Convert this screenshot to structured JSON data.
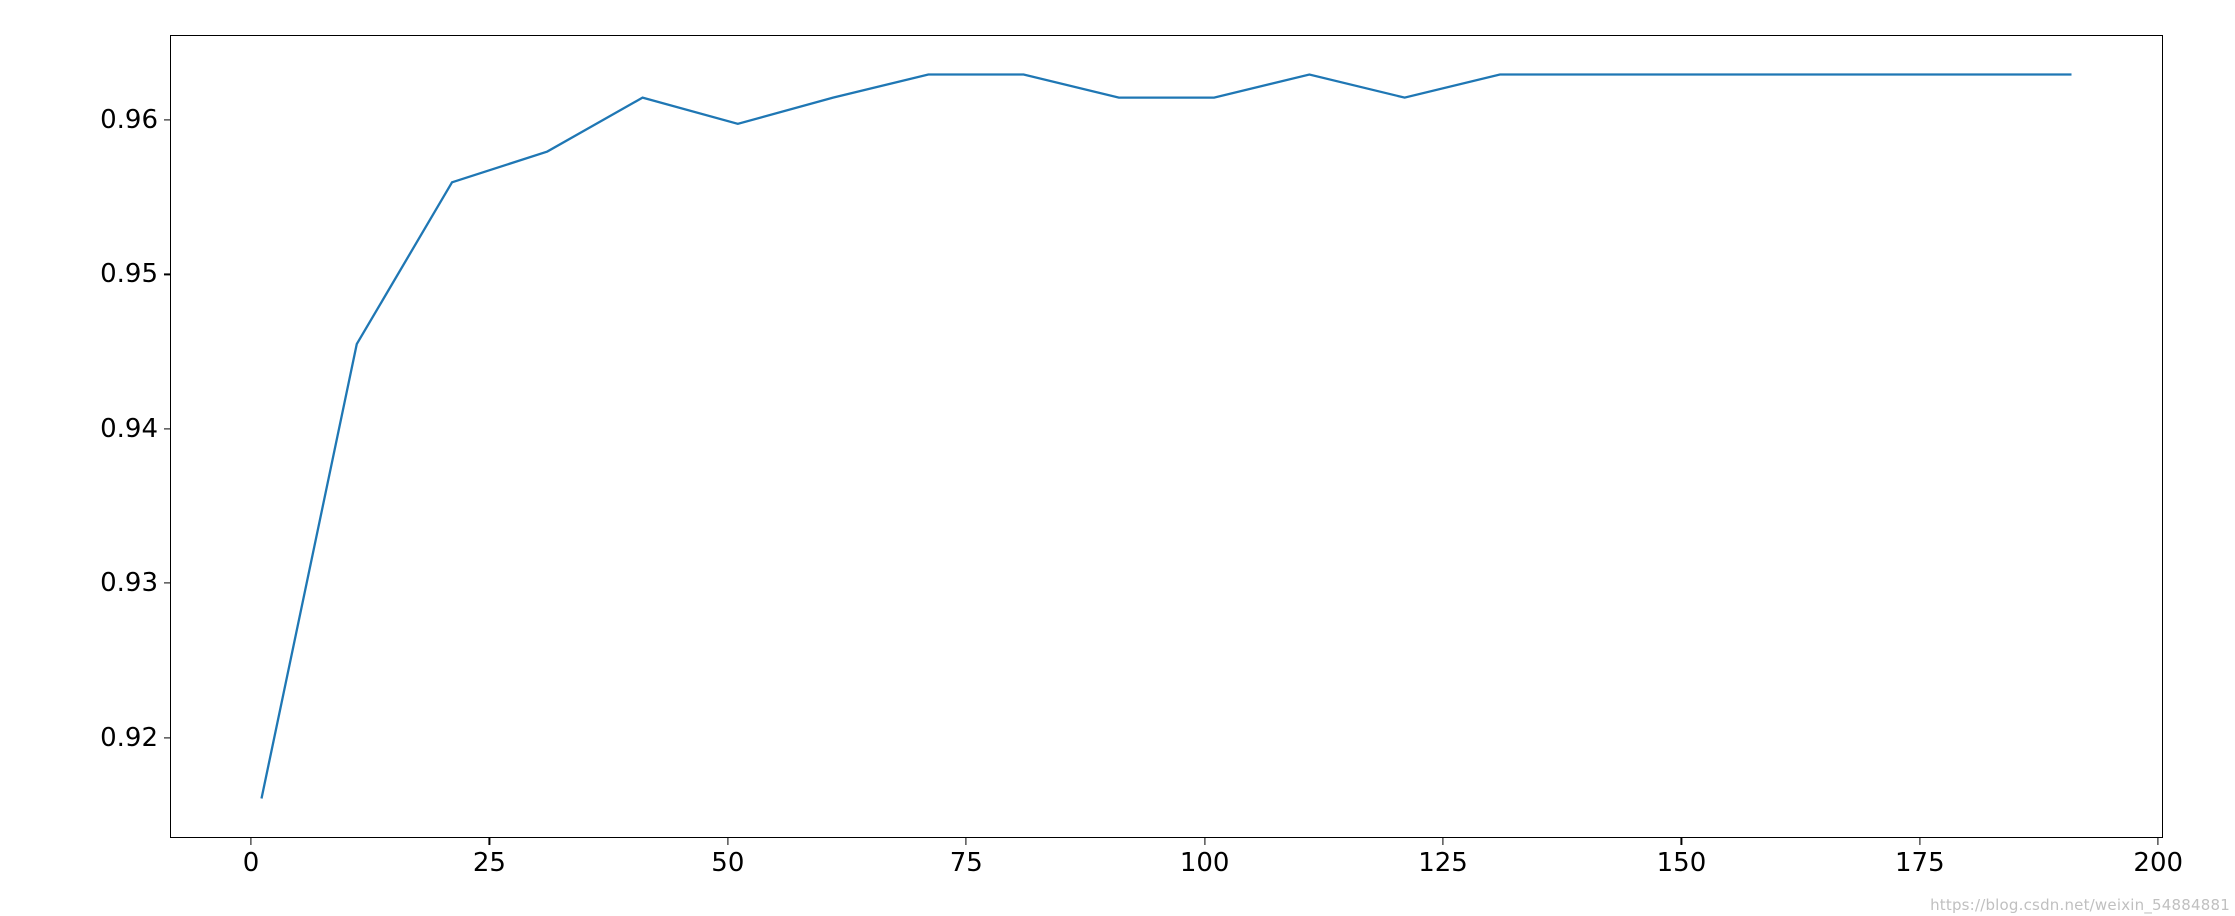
{
  "chart_data": {
    "type": "line",
    "x": [
      1,
      11,
      21,
      31,
      41,
      51,
      61,
      71,
      81,
      91,
      101,
      111,
      121,
      131,
      141,
      151,
      161,
      171,
      181,
      191
    ],
    "values": [
      0.916,
      0.9455,
      0.956,
      0.958,
      0.9615,
      0.9598,
      0.9615,
      0.963,
      0.963,
      0.9615,
      0.9615,
      0.963,
      0.9615,
      0.963,
      0.963,
      0.963,
      0.963,
      0.963,
      0.963,
      0.963
    ],
    "title": "",
    "xlabel": "",
    "ylabel": "",
    "xlim": [
      -8.5,
      200.5
    ],
    "ylim": [
      0.9135,
      0.9655
    ],
    "xticks": [
      0,
      25,
      50,
      75,
      100,
      125,
      150,
      175,
      200
    ],
    "yticks": [
      0.92,
      0.93,
      0.94,
      0.95,
      0.96
    ],
    "line_color": "#1f77b4"
  },
  "xtick_labels": {
    "0": "0",
    "1": "25",
    "2": "50",
    "3": "75",
    "4": "100",
    "5": "125",
    "6": "150",
    "7": "175",
    "8": "200"
  },
  "ytick_labels": {
    "0": "0.92",
    "1": "0.93",
    "2": "0.94",
    "3": "0.95",
    "4": "0.96"
  },
  "watermark": "https://blog.csdn.net/weixin_54884881"
}
